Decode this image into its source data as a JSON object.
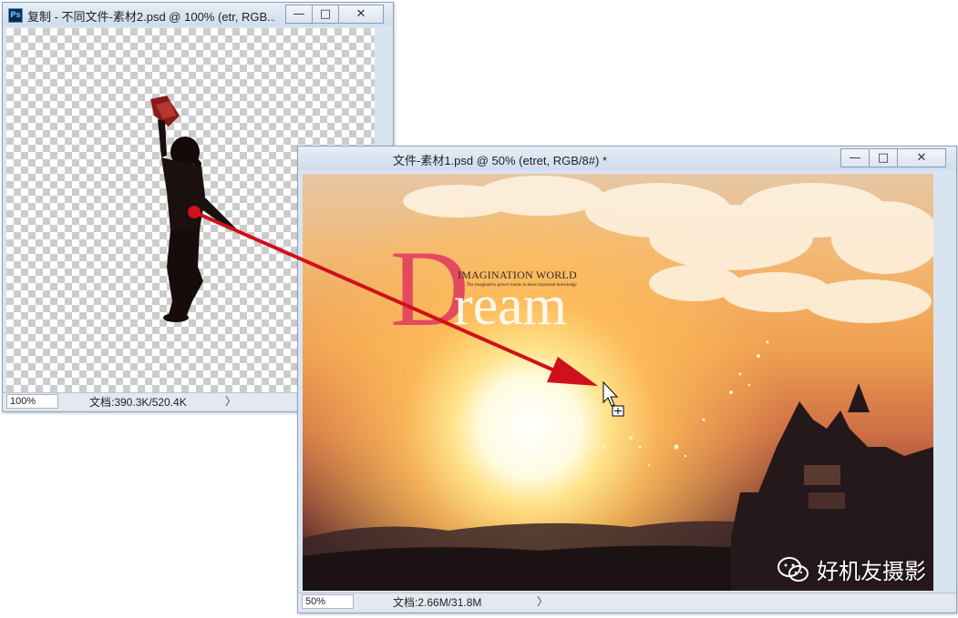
{
  "window_back": {
    "title": "复制 - 不同文件-素材2.psd @ 100% (etr, RGB...",
    "ps_label": "Ps",
    "zoom": "100%",
    "doc_info": "文档:390.3K/520.4K",
    "status_arrow": "〉",
    "controls": {
      "minimize": "—",
      "maximize": "□",
      "close": "✕"
    }
  },
  "window_front": {
    "title": "文件-素材1.psd @ 50% (etret, RGB/8#) *",
    "zoom": "50%",
    "doc_info": "文档:2.66M/31.8M",
    "status_arrow": "〉",
    "controls": {
      "minimize": "—",
      "maximize": "□",
      "close": "✕"
    }
  },
  "artwork": {
    "dream_letter": "D",
    "dream_rest": "ream",
    "heading": "IMAGINATION WORLD",
    "tagline": "The imaginative power rooms in more important knowledge"
  },
  "watermark": {
    "text": "好机友摄影"
  },
  "colors": {
    "arrow": "#d0101a",
    "titlebar": "#dbe5f2",
    "dream_red": "#e44a5e"
  },
  "icons": [
    "photoshop-icon",
    "minimize-icon",
    "maximize-icon",
    "close-icon",
    "move-cursor-icon",
    "wechat-icon"
  ]
}
